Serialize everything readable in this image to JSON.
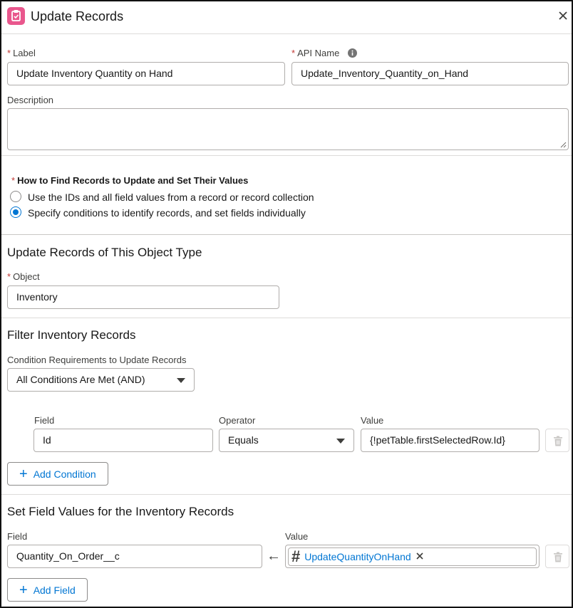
{
  "header": {
    "title": "Update Records",
    "icon": "clipboard-icon"
  },
  "label": {
    "label": "Label",
    "value": "Update Inventory Quantity on Hand"
  },
  "api_name": {
    "label": "API Name",
    "value": "Update_Inventory_Quantity_on_Hand",
    "info_icon": "info-icon"
  },
  "description": {
    "label": "Description",
    "value": ""
  },
  "how_to_find": {
    "label": "How to Find Records to Update and Set Their Values",
    "options": [
      {
        "label": "Use the IDs and all field values from a record or record collection",
        "selected": false
      },
      {
        "label": "Specify conditions to identify records, and set fields individually",
        "selected": true
      }
    ]
  },
  "object_section": {
    "title": "Update Records of This Object Type",
    "object_label": "Object",
    "object_value": "Inventory"
  },
  "filter_section": {
    "title": "Filter Inventory Records",
    "requirement_label": "Condition Requirements to Update Records",
    "requirement_value": "All Conditions Are Met (AND)",
    "columns": {
      "field": "Field",
      "operator": "Operator",
      "value": "Value"
    },
    "conditions": [
      {
        "field": "Id",
        "operator": "Equals",
        "value": "{!petTable.firstSelectedRow.Id}"
      }
    ],
    "add_condition_label": "Add Condition"
  },
  "set_fields_section": {
    "title": "Set Field Values for the Inventory Records",
    "field_label": "Field",
    "value_label": "Value",
    "rows": [
      {
        "field": "Quantity_On_Order__c",
        "value": "UpdateQuantityOnHand"
      }
    ],
    "add_field_label": "Add Field"
  },
  "colors": {
    "accent": "#0176d3",
    "required": "#c23934",
    "brand_icon": "#e9578d"
  }
}
